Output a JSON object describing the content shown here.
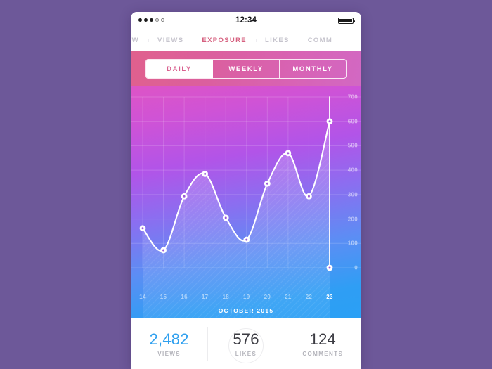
{
  "status_bar": {
    "signal_filled": 3,
    "signal_empty": 2,
    "time": "12:34",
    "battery_icon": "battery-full-icon"
  },
  "tabs": [
    {
      "label": "EW",
      "full": "OVERVIEW",
      "active": false
    },
    {
      "label": "VIEWS",
      "active": false
    },
    {
      "label": "EXPOSURE",
      "active": true
    },
    {
      "label": "LIKES",
      "active": false
    },
    {
      "label": "COMM",
      "full": "COMMENTS",
      "active": false
    }
  ],
  "segments": [
    {
      "label": "DAILY",
      "active": true
    },
    {
      "label": "WEEKLY",
      "active": false
    },
    {
      "label": "MONTHLY",
      "active": false
    }
  ],
  "chart_data": {
    "type": "line",
    "title": "",
    "xlabel": "OCTOBER 2015",
    "ylabel": "",
    "x": [
      14,
      15,
      16,
      17,
      18,
      19,
      20,
      21,
      22,
      23
    ],
    "categories": [
      "14",
      "15",
      "16",
      "17",
      "18",
      "19",
      "20",
      "21",
      "22",
      "23"
    ],
    "values": [
      162,
      72,
      293,
      385,
      205,
      115,
      345,
      470,
      293,
      600
    ],
    "series": [
      {
        "name": "Exposure",
        "values": [
          162,
          72,
          293,
          385,
          205,
          115,
          345,
          470,
          293,
          600
        ]
      }
    ],
    "ylim": [
      0,
      700
    ],
    "yticks": [
      0,
      100,
      200,
      300,
      400,
      500,
      600,
      700
    ],
    "ytick_labels": [
      "0",
      "100",
      "200",
      "300",
      "400",
      "500",
      "600",
      "700"
    ],
    "grid": true,
    "legend": "none",
    "highlighted_x": "23",
    "colors": {
      "line": "#ffffff",
      "gradient_top": "#dd54c6",
      "gradient_mid": "#8b6ef0",
      "gradient_bottom": "#2aa0f5",
      "accent_pink": "#d6607f",
      "accent_blue": "#2fa0ef"
    }
  },
  "month_label": "OCTOBER 2015",
  "footer_stats": [
    {
      "value": "2,482",
      "label": "VIEWS",
      "accent": true
    },
    {
      "value": "576",
      "label": "LIKES",
      "accent": false,
      "ring": true
    },
    {
      "value": "124",
      "label": "COMMENTS",
      "accent": false
    }
  ]
}
